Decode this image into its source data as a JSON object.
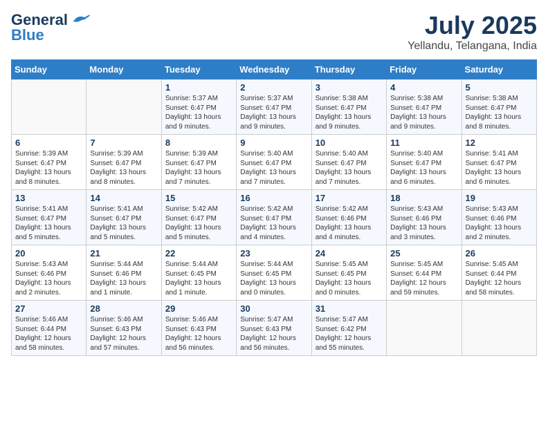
{
  "header": {
    "logo_line1": "General",
    "logo_line2": "Blue",
    "title": "July 2025",
    "subtitle": "Yellandu, Telangana, India"
  },
  "weekdays": [
    "Sunday",
    "Monday",
    "Tuesday",
    "Wednesday",
    "Thursday",
    "Friday",
    "Saturday"
  ],
  "weeks": [
    [
      {
        "day": "",
        "info": ""
      },
      {
        "day": "",
        "info": ""
      },
      {
        "day": "1",
        "info": "Sunrise: 5:37 AM\nSunset: 6:47 PM\nDaylight: 13 hours\nand 9 minutes."
      },
      {
        "day": "2",
        "info": "Sunrise: 5:37 AM\nSunset: 6:47 PM\nDaylight: 13 hours\nand 9 minutes."
      },
      {
        "day": "3",
        "info": "Sunrise: 5:38 AM\nSunset: 6:47 PM\nDaylight: 13 hours\nand 9 minutes."
      },
      {
        "day": "4",
        "info": "Sunrise: 5:38 AM\nSunset: 6:47 PM\nDaylight: 13 hours\nand 9 minutes."
      },
      {
        "day": "5",
        "info": "Sunrise: 5:38 AM\nSunset: 6:47 PM\nDaylight: 13 hours\nand 8 minutes."
      }
    ],
    [
      {
        "day": "6",
        "info": "Sunrise: 5:39 AM\nSunset: 6:47 PM\nDaylight: 13 hours\nand 8 minutes."
      },
      {
        "day": "7",
        "info": "Sunrise: 5:39 AM\nSunset: 6:47 PM\nDaylight: 13 hours\nand 8 minutes."
      },
      {
        "day": "8",
        "info": "Sunrise: 5:39 AM\nSunset: 6:47 PM\nDaylight: 13 hours\nand 7 minutes."
      },
      {
        "day": "9",
        "info": "Sunrise: 5:40 AM\nSunset: 6:47 PM\nDaylight: 13 hours\nand 7 minutes."
      },
      {
        "day": "10",
        "info": "Sunrise: 5:40 AM\nSunset: 6:47 PM\nDaylight: 13 hours\nand 7 minutes."
      },
      {
        "day": "11",
        "info": "Sunrise: 5:40 AM\nSunset: 6:47 PM\nDaylight: 13 hours\nand 6 minutes."
      },
      {
        "day": "12",
        "info": "Sunrise: 5:41 AM\nSunset: 6:47 PM\nDaylight: 13 hours\nand 6 minutes."
      }
    ],
    [
      {
        "day": "13",
        "info": "Sunrise: 5:41 AM\nSunset: 6:47 PM\nDaylight: 13 hours\nand 5 minutes."
      },
      {
        "day": "14",
        "info": "Sunrise: 5:41 AM\nSunset: 6:47 PM\nDaylight: 13 hours\nand 5 minutes."
      },
      {
        "day": "15",
        "info": "Sunrise: 5:42 AM\nSunset: 6:47 PM\nDaylight: 13 hours\nand 5 minutes."
      },
      {
        "day": "16",
        "info": "Sunrise: 5:42 AM\nSunset: 6:47 PM\nDaylight: 13 hours\nand 4 minutes."
      },
      {
        "day": "17",
        "info": "Sunrise: 5:42 AM\nSunset: 6:46 PM\nDaylight: 13 hours\nand 4 minutes."
      },
      {
        "day": "18",
        "info": "Sunrise: 5:43 AM\nSunset: 6:46 PM\nDaylight: 13 hours\nand 3 minutes."
      },
      {
        "day": "19",
        "info": "Sunrise: 5:43 AM\nSunset: 6:46 PM\nDaylight: 13 hours\nand 2 minutes."
      }
    ],
    [
      {
        "day": "20",
        "info": "Sunrise: 5:43 AM\nSunset: 6:46 PM\nDaylight: 13 hours\nand 2 minutes."
      },
      {
        "day": "21",
        "info": "Sunrise: 5:44 AM\nSunset: 6:46 PM\nDaylight: 13 hours\nand 1 minute."
      },
      {
        "day": "22",
        "info": "Sunrise: 5:44 AM\nSunset: 6:45 PM\nDaylight: 13 hours\nand 1 minute."
      },
      {
        "day": "23",
        "info": "Sunrise: 5:44 AM\nSunset: 6:45 PM\nDaylight: 13 hours\nand 0 minutes."
      },
      {
        "day": "24",
        "info": "Sunrise: 5:45 AM\nSunset: 6:45 PM\nDaylight: 13 hours\nand 0 minutes."
      },
      {
        "day": "25",
        "info": "Sunrise: 5:45 AM\nSunset: 6:44 PM\nDaylight: 12 hours\nand 59 minutes."
      },
      {
        "day": "26",
        "info": "Sunrise: 5:45 AM\nSunset: 6:44 PM\nDaylight: 12 hours\nand 58 minutes."
      }
    ],
    [
      {
        "day": "27",
        "info": "Sunrise: 5:46 AM\nSunset: 6:44 PM\nDaylight: 12 hours\nand 58 minutes."
      },
      {
        "day": "28",
        "info": "Sunrise: 5:46 AM\nSunset: 6:43 PM\nDaylight: 12 hours\nand 57 minutes."
      },
      {
        "day": "29",
        "info": "Sunrise: 5:46 AM\nSunset: 6:43 PM\nDaylight: 12 hours\nand 56 minutes."
      },
      {
        "day": "30",
        "info": "Sunrise: 5:47 AM\nSunset: 6:43 PM\nDaylight: 12 hours\nand 56 minutes."
      },
      {
        "day": "31",
        "info": "Sunrise: 5:47 AM\nSunset: 6:42 PM\nDaylight: 12 hours\nand 55 minutes."
      },
      {
        "day": "",
        "info": ""
      },
      {
        "day": "",
        "info": ""
      }
    ]
  ]
}
